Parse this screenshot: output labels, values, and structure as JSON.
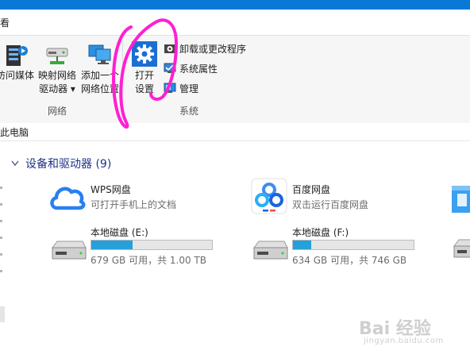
{
  "tabbar": {
    "view_tab": "看"
  },
  "ribbon": {
    "network_group": {
      "label": "网络",
      "media_line1": "访问媒体",
      "map_drive_line1": "映射网络",
      "map_drive_line2": "驱动器 ▾",
      "add_location_line1": "添加一个",
      "add_location_line2": "网络位置"
    },
    "system_group": {
      "label": "系统",
      "open_settings_line1": "打开",
      "open_settings_line2": "设置",
      "uninstall": "卸载或更改程序",
      "properties": "系统属性",
      "manage": "管理"
    }
  },
  "address": {
    "path": "此电脑"
  },
  "section": {
    "title": "设备和驱动器 (9)"
  },
  "items": {
    "wps": {
      "name": "WPS网盘",
      "desc": "可打开手机上的文档"
    },
    "baidu": {
      "name": "百度网盘",
      "desc": "双击运行百度网盘"
    },
    "disk_e": {
      "name": "本地磁盘 (E:)",
      "info": "679 GB 可用，共 1.00 TB",
      "used_fraction": 0.34
    },
    "disk_f": {
      "name": "本地磁盘 (F:)",
      "info": "634 GB 可用，共 746 GB",
      "used_fraction": 0.15
    }
  },
  "watermark": {
    "text": "Bai 经验",
    "url": "jingyan.baidu.com"
  },
  "colors": {
    "title_blue": "#0a78d7",
    "accent": "#26a0da",
    "section_blue": "#1e3287",
    "annotation": "#ff1fd2"
  }
}
